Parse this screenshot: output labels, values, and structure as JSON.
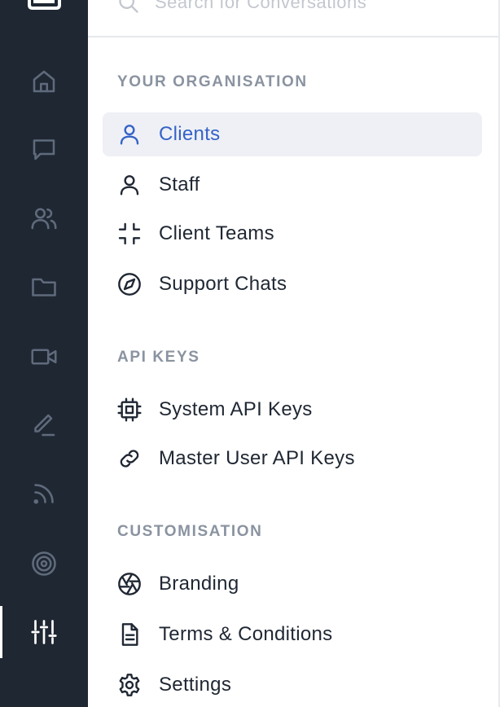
{
  "search": {
    "placeholder": "Search for Conversations"
  },
  "rail": {
    "items": [
      {
        "name": "home",
        "icon": "home-icon"
      },
      {
        "name": "messages",
        "icon": "chat-bubble-icon"
      },
      {
        "name": "people",
        "icon": "users-icon"
      },
      {
        "name": "files",
        "icon": "folder-icon"
      },
      {
        "name": "video",
        "icon": "video-camera-icon"
      },
      {
        "name": "edit",
        "icon": "pencil-icon"
      },
      {
        "name": "feed",
        "icon": "rss-icon"
      },
      {
        "name": "target",
        "icon": "target-icon"
      },
      {
        "name": "admin",
        "icon": "sliders-icon",
        "active": true
      }
    ]
  },
  "sections": {
    "organisation": {
      "heading": "YOUR ORGANISATION",
      "items": [
        {
          "label": "Clients",
          "icon": "user-icon",
          "active": true
        },
        {
          "label": "Staff",
          "icon": "user-icon"
        },
        {
          "label": "Client Teams",
          "icon": "collapse-icon"
        },
        {
          "label": "Support Chats",
          "icon": "compass-icon"
        }
      ]
    },
    "api_keys": {
      "heading": "API KEYS",
      "items": [
        {
          "label": "System API Keys",
          "icon": "chip-icon"
        },
        {
          "label": "Master User API Keys",
          "icon": "link-icon"
        }
      ]
    },
    "customisation": {
      "heading": "CUSTOMISATION",
      "items": [
        {
          "label": "Branding",
          "icon": "aperture-icon"
        },
        {
          "label": "Terms & Conditions",
          "icon": "document-icon"
        },
        {
          "label": "Settings",
          "icon": "gear-icon"
        }
      ]
    }
  },
  "colors": {
    "rail_bg": "#1f2733",
    "rail_icon": "#5f6b7c",
    "rail_active_icon": "#ffffff",
    "accent": "#3562c7",
    "active_bg": "#eef0f5",
    "heading": "#8a93a0",
    "text": "#1f2733"
  }
}
